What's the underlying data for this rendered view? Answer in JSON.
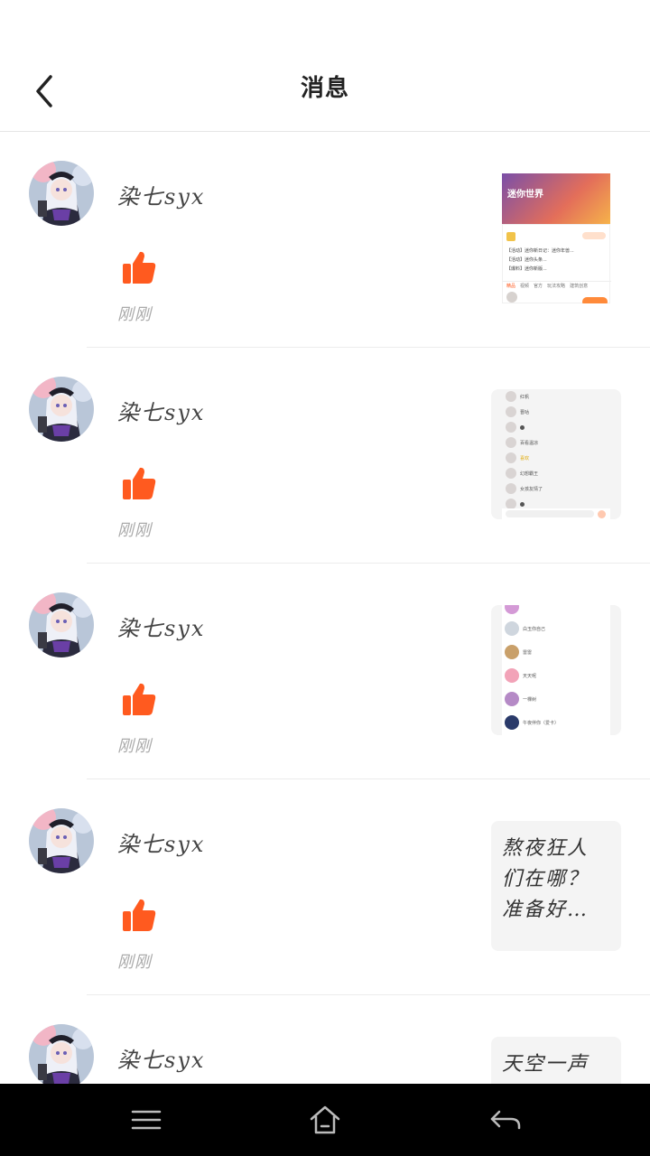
{
  "header": {
    "title": "消息"
  },
  "messages": [
    {
      "username": "染七syx",
      "time": "刚刚",
      "thumb_type": "screenshot-game-world"
    },
    {
      "username": "染七syx",
      "time": "刚刚",
      "thumb_type": "screenshot-chat-list"
    },
    {
      "username": "染七syx",
      "time": "刚刚",
      "thumb_type": "screenshot-user-list"
    },
    {
      "username": "染七syx",
      "time": "刚刚",
      "thumb_type": "text",
      "thumb_text": "熬夜狂人\n们在哪？\n准备好…"
    },
    {
      "username": "染七syx",
      "time": "",
      "thumb_type": "text",
      "thumb_text": "天空一声"
    }
  ],
  "thumb1": {
    "banner_title": "迷你世界",
    "lines": [
      "【活动】迷你新日记：迷你年兽...",
      "【活动】迷你头条...",
      "【爆料】迷你新版..."
    ],
    "tabs": [
      "精品",
      "视频",
      "官方",
      "玩法攻略",
      "建筑创意",
      "学习"
    ]
  },
  "thumb2": {
    "rows": [
      "红帆",
      "晋咕",
      "",
      "百看温凉",
      "喜欢",
      "幻想霸王",
      "女孩友情了",
      ""
    ]
  },
  "thumb3": {
    "rows": [
      "",
      "白玉你自己",
      "雷雷",
      "天天呢",
      "一棵树",
      "午夜伴你（爱卡）"
    ]
  },
  "colors": {
    "accent": "#ff5a1f",
    "nav_bg": "#000000",
    "divider": "#ececec"
  },
  "icons": {
    "back": "chevron-left-icon",
    "like": "thumbs-up-icon",
    "menu": "menu-icon",
    "home": "home-icon",
    "nav_back": "return-icon"
  }
}
